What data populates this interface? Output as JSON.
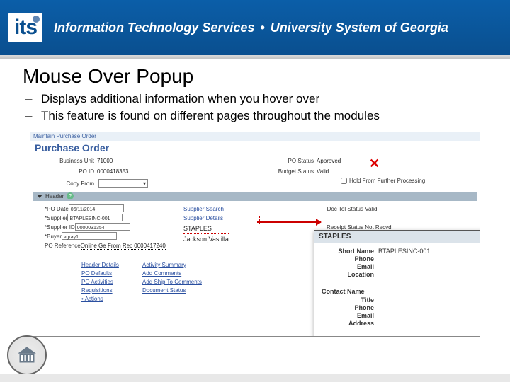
{
  "banner": {
    "logo": "its",
    "line": "Information Technology Services",
    "org": "University System of Georgia"
  },
  "slide": {
    "title": "Mouse Over Popup",
    "bullets": [
      "Displays additional information when you hover over",
      "This feature is found on different pages throughout the modules"
    ]
  },
  "po": {
    "crumb": "Maintain Purchase Order",
    "title": "Purchase Order",
    "left": {
      "bu_label": "Business Unit",
      "bu": "71000",
      "poid_label": "PO ID",
      "poid": "0000418353",
      "copy_label": "Copy From"
    },
    "right": {
      "status_label": "PO Status",
      "status": "Approved",
      "budget_label": "Budget Status",
      "budget": "Valid",
      "hold_label": "Hold From Further Processing"
    },
    "header_label": "Header",
    "detail": {
      "po_date_label": "*PO Date",
      "po_date": "06/11/2014",
      "supplier_label": "*Supplier",
      "supplier": "BTAPLESINC-001",
      "supplier_id_label": "*Supplier ID",
      "supplier_id": "0000031354",
      "buyer_label": "*Buyer",
      "buyer": "vgray1",
      "po_ref_label": "PO Reference",
      "po_ref": "Online Ge From Rec 0000417240"
    },
    "links_a": [
      "Supplier Search",
      "Supplier Details"
    ],
    "supplier_name": "STAPLES",
    "buyer_name": "Jackson,Vastilla",
    "links_b": [
      "Header Details",
      "PO Defaults",
      "PO Activities",
      "Requisitions",
      "• Actions"
    ],
    "links_c": [
      "Activity Summary",
      "Add Comments",
      "Add Ship To Comments",
      "Document Status"
    ],
    "status_rows": {
      "doc_tol_label": "Doc Tol Status",
      "doc_tol": "Valid",
      "receipt_label": "Receipt Status",
      "receipt": "Not Recvd"
    }
  },
  "popup": {
    "title": "STAPLES",
    "rows": {
      "short_name_label": "Short Name",
      "short_name": "BTAPLESINC-001",
      "phone_label": "Phone",
      "email_label": "Email",
      "location_label": "Location"
    },
    "contact_header": "Contact Name",
    "contact": {
      "title_label": "Title",
      "phone_label": "Phone",
      "email_label": "Email",
      "address_label": "Address"
    }
  }
}
